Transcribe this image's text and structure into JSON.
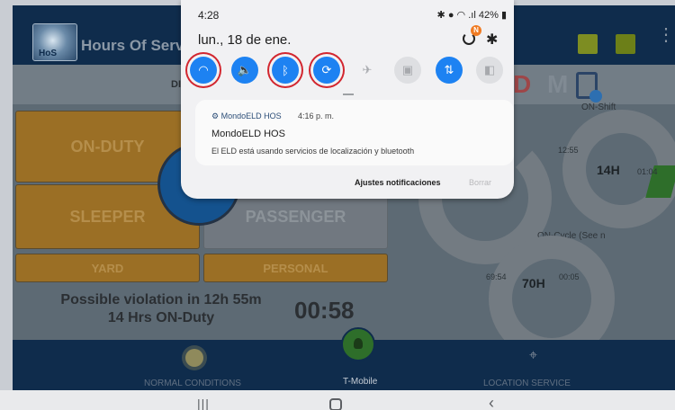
{
  "app": {
    "title": "Hours Of Servic",
    "logo_text": "HoS",
    "strip_label": "DI",
    "letters": [
      "D",
      "M"
    ],
    "on_shift_label": "ON-Shift",
    "on_cycle_label": "ON-Cycle (See n",
    "duty_buttons": {
      "on_duty": "ON-DUTY",
      "sleeper": "SLEEPER",
      "passenger": "PASSENGER",
      "yard": "YARD",
      "personal": "PERSONAL"
    },
    "violation_line1": "Possible violation in 12h 55m",
    "violation_line2": "14 Hrs ON-Duty",
    "timer": "00:58",
    "shift_gauge": {
      "hours": "14H",
      "left": "12:55",
      "right": "01:04"
    },
    "cycle_gauge": {
      "hours": "70H",
      "left": "69:54",
      "right": "00:05"
    },
    "bottom": {
      "normal": "NORMAL CONDITIONS",
      "carrier": "T-Mobile",
      "location": "LOCATION SERVICE"
    }
  },
  "shade": {
    "time": "4:28",
    "battery": "42%",
    "date": "lun., 18 de ene.",
    "n_badge": "N",
    "quick_settings": [
      {
        "icon": "wifi-icon",
        "state": "on",
        "highlighted": true
      },
      {
        "icon": "sound-icon",
        "state": "on",
        "highlighted": false
      },
      {
        "icon": "bluetooth-icon",
        "state": "on",
        "highlighted": true
      },
      {
        "icon": "auto-rotate-icon",
        "state": "on",
        "highlighted": true
      },
      {
        "icon": "airplane-icon",
        "state": "off",
        "highlighted": false
      },
      {
        "icon": "flashlight-icon",
        "state": "off",
        "highlighted": false
      },
      {
        "icon": "mobile-data-icon",
        "state": "on",
        "highlighted": false
      },
      {
        "icon": "power-saving-icon",
        "state": "off",
        "highlighted": false
      }
    ],
    "notification": {
      "app": "MondoELD HOS",
      "time": "4:16 p. m.",
      "title": "MondoELD HOS",
      "body": "El ELD está usando servicios de localización y bluetooth"
    },
    "actions": {
      "settings": "Ajustes notificaciones",
      "clear": "Borrar"
    }
  },
  "colors": {
    "accent": "#1d82f2",
    "highlight_ring": "#d2262f"
  }
}
